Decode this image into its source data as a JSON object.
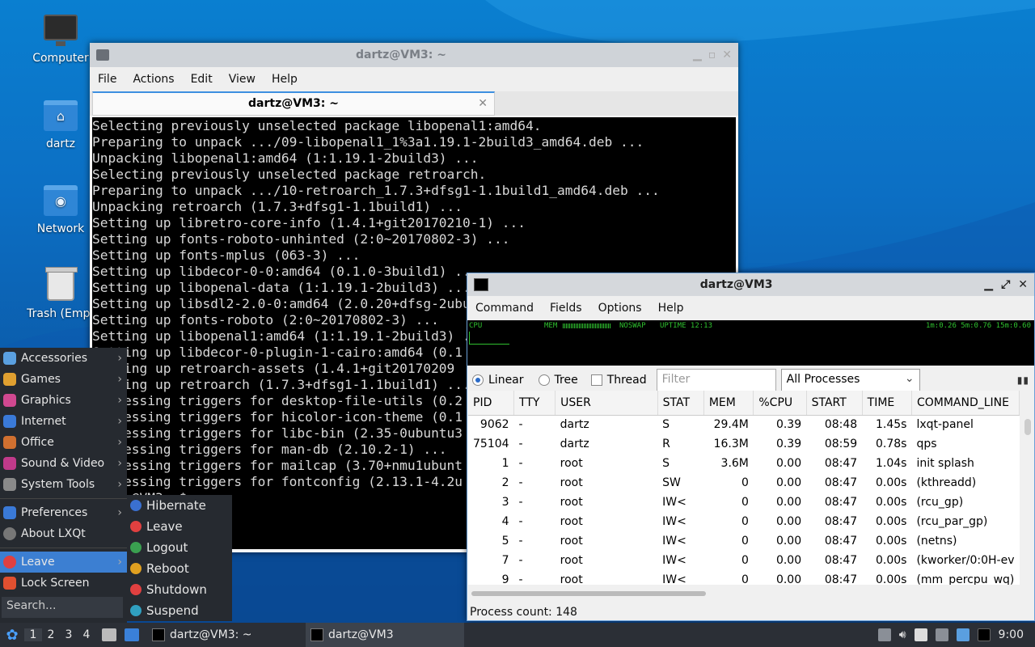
{
  "desktop": {
    "icons": [
      {
        "label": "Computer",
        "icon": "computer-icon"
      },
      {
        "label": "dartz",
        "icon": "home-folder-icon"
      },
      {
        "label": "Network",
        "icon": "network-folder-icon"
      },
      {
        "label": "Trash (Empt",
        "icon": "trash-icon"
      }
    ]
  },
  "terminal": {
    "title": "dartz@VM3: ~",
    "menu": [
      "File",
      "Actions",
      "Edit",
      "View",
      "Help"
    ],
    "tab_title": "dartz@VM3: ~",
    "lines": [
      "Selecting previously unselected package libopenal1:amd64.",
      "Preparing to unpack .../09-libopenal1_1%3a1.19.1-2build3_amd64.deb ...",
      "Unpacking libopenal1:amd64 (1:1.19.1-2build3) ...",
      "Selecting previously unselected package retroarch.",
      "Preparing to unpack .../10-retroarch_1.7.3+dfsg1-1.1build1_amd64.deb ...",
      "Unpacking retroarch (1.7.3+dfsg1-1.1build1) ...",
      "Setting up libretro-core-info (1.4.1+git20170210-1) ...",
      "Setting up fonts-roboto-unhinted (2:0~20170802-3) ...",
      "Setting up fonts-mplus (063-3) ...",
      "Setting up libdecor-0-0:amd64 (0.1.0-3build1) ...",
      "Setting up libopenal-data (1:1.19.1-2build3) ...",
      "Setting up libsdl2-2.0-0:amd64 (2.0.20+dfsg-2ubu",
      "Setting up fonts-roboto (2:0~20170802-3) ...",
      "Setting up libopenal1:amd64 (1:1.19.1-2build3) ...",
      "Setting up libdecor-0-plugin-1-cairo:amd64 (0.1",
      "Setting up retroarch-assets (1.4.1+git20170209",
      "Setting up retroarch (1.7.3+dfsg1-1.1build1) ...",
      "Processing triggers for desktop-file-utils (0.2",
      "Processing triggers for hicolor-icon-theme (0.1",
      "Processing triggers for libc-bin (2.35-0ubuntu3",
      "Processing triggers for man-db (2.10.2-1) ...",
      "Processing triggers for mailcap (3.70+nmu1ubunt",
      "Processing triggers for fontconfig (2.13.1-4.2u",
      "dartz@VM3:~$ "
    ]
  },
  "qps": {
    "title": "dartz@VM3",
    "menu": [
      "Command",
      "Fields",
      "Options",
      "Help"
    ],
    "graph": {
      "cpu": "CPU",
      "mem": "MEM",
      "noswap": "NOSWAP",
      "uptime": "UPTIME 12:13",
      "load": "1m:0.26 5m:0.76 15m:0.60"
    },
    "view_modes": [
      "Linear",
      "Tree"
    ],
    "thread_label": "Thread",
    "filter_placeholder": "Filter",
    "process_filter": "All Processes",
    "columns": [
      "PID",
      "TTY",
      "USER",
      "STAT",
      "MEM",
      "%CPU",
      "START",
      "TIME",
      "COMMAND_LINE"
    ],
    "rows": [
      [
        "9062",
        "-",
        "dartz",
        "S",
        "29.4M",
        "0.39",
        "08:48",
        "1.45s",
        "lxqt-panel"
      ],
      [
        "75104",
        "-",
        "dartz",
        "R",
        "16.3M",
        "0.39",
        "08:59",
        "0.78s",
        "qps"
      ],
      [
        "1",
        "-",
        "root",
        "S",
        "3.6M",
        "0.00",
        "08:47",
        "1.04s",
        "init splash"
      ],
      [
        "2",
        "-",
        "root",
        "SW",
        "0",
        "0.00",
        "08:47",
        "0.00s",
        "(kthreadd)"
      ],
      [
        "3",
        "-",
        "root",
        "IW<",
        "0",
        "0.00",
        "08:47",
        "0.00s",
        "(rcu_gp)"
      ],
      [
        "4",
        "-",
        "root",
        "IW<",
        "0",
        "0.00",
        "08:47",
        "0.00s",
        "(rcu_par_gp)"
      ],
      [
        "5",
        "-",
        "root",
        "IW<",
        "0",
        "0.00",
        "08:47",
        "0.00s",
        "(netns)"
      ],
      [
        "7",
        "-",
        "root",
        "IW<",
        "0",
        "0.00",
        "08:47",
        "0.00s",
        "(kworker/0:0H-ev"
      ],
      [
        "9",
        "-",
        "root",
        "IW<",
        "0",
        "0.00",
        "08:47",
        "0.00s",
        "(mm_percpu_wq)"
      ]
    ],
    "status": "Process count: 148"
  },
  "menu": {
    "categories": [
      {
        "label": "Accessories",
        "color": "#5aa0e0"
      },
      {
        "label": "Games",
        "color": "#e0a030"
      },
      {
        "label": "Graphics",
        "color": "#d04890"
      },
      {
        "label": "Internet",
        "color": "#3a7ad8"
      },
      {
        "label": "Office",
        "color": "#d07030"
      },
      {
        "label": "Sound & Video",
        "color": "#c03a8a"
      },
      {
        "label": "System Tools",
        "color": "#8a8a8a"
      }
    ],
    "preferences": "Preferences",
    "about": "About LXQt",
    "leave": "Leave",
    "lock": "Lock Screen",
    "search_placeholder": "Search...",
    "leave_submenu": [
      {
        "label": "Hibernate",
        "color": "#3a70d0"
      },
      {
        "label": "Leave",
        "color": "#e04040"
      },
      {
        "label": "Logout",
        "color": "#3aa050"
      },
      {
        "label": "Reboot",
        "color": "#e0a020"
      },
      {
        "label": "Shutdown",
        "color": "#e04040"
      },
      {
        "label": "Suspend",
        "color": "#30a0c0"
      }
    ]
  },
  "taskbar": {
    "workspaces": [
      "1",
      "2",
      "3",
      "4"
    ],
    "tasks": [
      "dartz@VM3: ~",
      "dartz@VM3"
    ],
    "clock": "9:00"
  }
}
